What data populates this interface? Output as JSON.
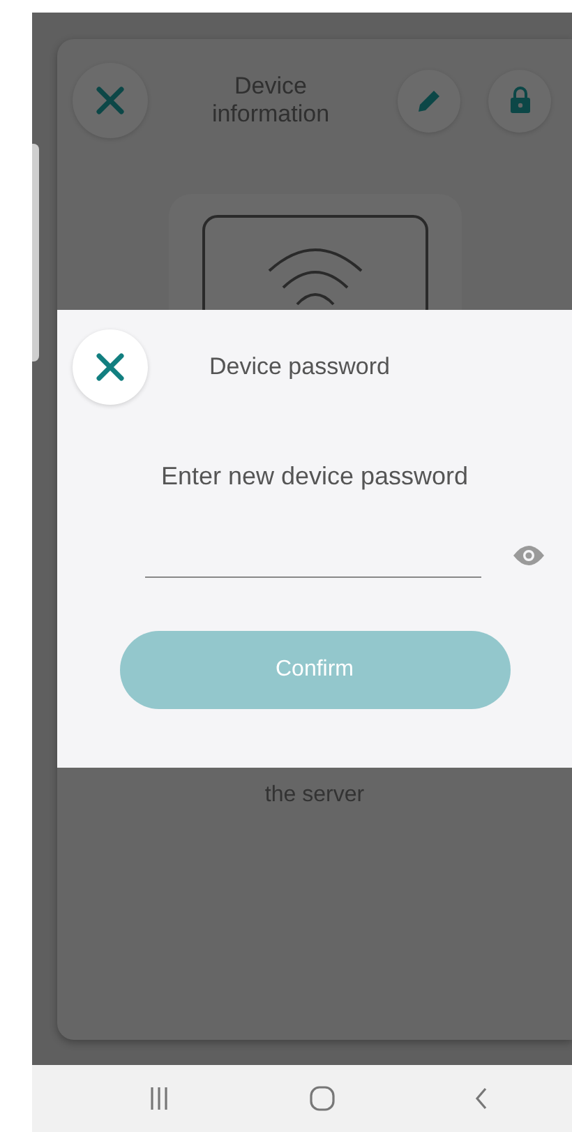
{
  "background_screen": {
    "title": "Device information",
    "partial_text": "the server"
  },
  "dialog": {
    "title": "Device password",
    "prompt": "Enter new device password",
    "confirm_button": {
      "label": "Confirm",
      "disabled": true
    }
  }
}
